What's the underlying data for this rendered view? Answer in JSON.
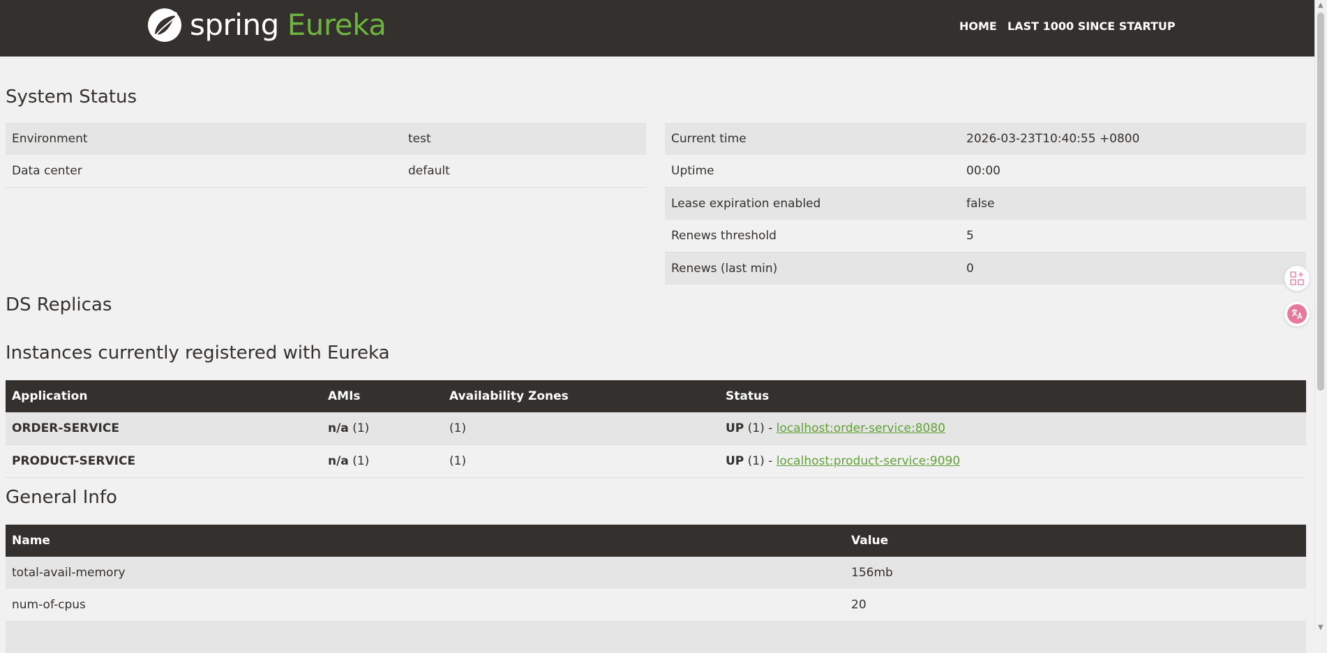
{
  "header": {
    "logo_spring": "spring",
    "logo_eureka": "Eureka",
    "nav": [
      "HOME",
      "LAST 1000 SINCE STARTUP"
    ]
  },
  "system_status": {
    "title": "System Status",
    "left_rows": [
      {
        "label": "Environment",
        "value": "test"
      },
      {
        "label": "Data center",
        "value": "default"
      }
    ],
    "right_rows": [
      {
        "label": "Current time",
        "value": "2026-03-23T10:40:55 +0800"
      },
      {
        "label": "Uptime",
        "value": "00:00"
      },
      {
        "label": "Lease expiration enabled",
        "value": "false"
      },
      {
        "label": "Renews threshold",
        "value": "5"
      },
      {
        "label": "Renews (last min)",
        "value": "0"
      }
    ]
  },
  "ds_replicas": {
    "title": "DS Replicas"
  },
  "instances": {
    "title": "Instances currently registered with Eureka",
    "headers": [
      "Application",
      "AMIs",
      "Availability Zones",
      "Status"
    ],
    "rows": [
      {
        "application": "ORDER-SERVICE",
        "amis_bold": "n/a",
        "amis_count": " (1)",
        "zones": "(1)",
        "status_bold": "UP",
        "status_count": " (1) - ",
        "link": "localhost:order-service:8080"
      },
      {
        "application": "PRODUCT-SERVICE",
        "amis_bold": "n/a",
        "amis_count": " (1)",
        "zones": "(1)",
        "status_bold": "UP",
        "status_count": " (1) - ",
        "link": "localhost:product-service:9090"
      }
    ]
  },
  "general_info": {
    "title": "General Info",
    "headers": [
      "Name",
      "Value"
    ],
    "rows": [
      {
        "name": "total-avail-memory",
        "value": "156mb"
      },
      {
        "name": "num-of-cpus",
        "value": "20"
      }
    ]
  },
  "colors": {
    "header_bg": "#34302d",
    "brand_green": "#6db33f",
    "link_green": "#5fa134",
    "row_stripe": "#e5e5e5",
    "page_bg": "#f1f1f1"
  },
  "icons": [
    "spring-logo-icon",
    "apps-add-icon",
    "translate-icon"
  ]
}
